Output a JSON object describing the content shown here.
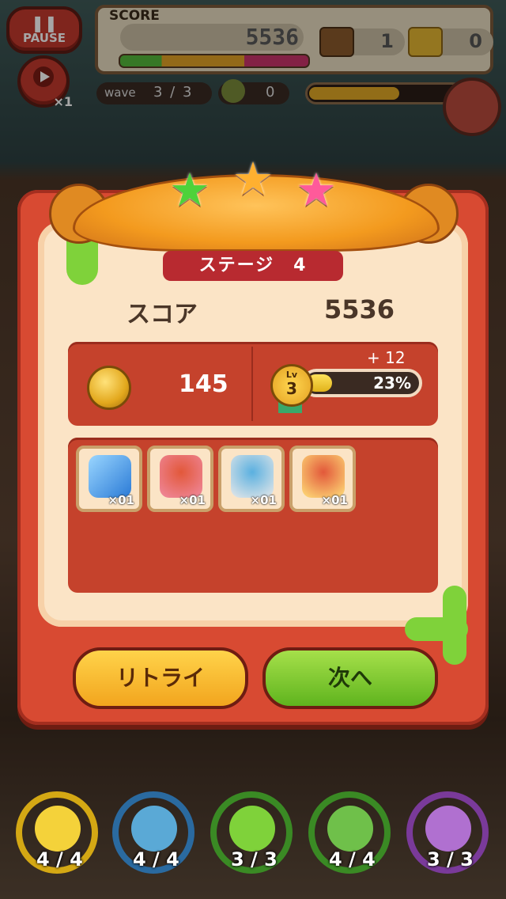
{
  "hud": {
    "pause_label": "PAUSE",
    "speed_label": "×1",
    "score_label": "SCORE",
    "score_value": "5536",
    "chest_count": "1",
    "gold_chest_count": "0",
    "wave_label": "wave",
    "wave_value": "3 / 3",
    "enemy_count": "0",
    "boss_progress": 0.6
  },
  "dialog": {
    "stars": [
      "green-star",
      "orange-star",
      "pink-star"
    ],
    "stage_label": "ステージ　4",
    "score_label": "スコア",
    "score_value": "5536",
    "coins": "145",
    "exp_gain": "+ 12",
    "level_prefix": "Lv",
    "level": "3",
    "exp_percent_label": "23%",
    "exp_percent": 0.23,
    "items": [
      {
        "icon": "blue-board-icon",
        "count": "×01"
      },
      {
        "icon": "cart-unit-icon",
        "count": "×01"
      },
      {
        "icon": "egg-unit-icon",
        "count": "×01"
      },
      {
        "icon": "cannon-unit-icon",
        "count": "×01"
      }
    ],
    "retry_label": "リトライ",
    "next_label": "次へ"
  },
  "units": [
    {
      "hp": "4 / 4",
      "color": "#f4d23a"
    },
    {
      "hp": "4 / 4",
      "color": "#5aa9d6"
    },
    {
      "hp": "3 / 3",
      "color": "#7fd23a"
    },
    {
      "hp": "4 / 4",
      "color": "#6fc04a"
    },
    {
      "hp": "3 / 3",
      "color": "#b070d0"
    }
  ]
}
